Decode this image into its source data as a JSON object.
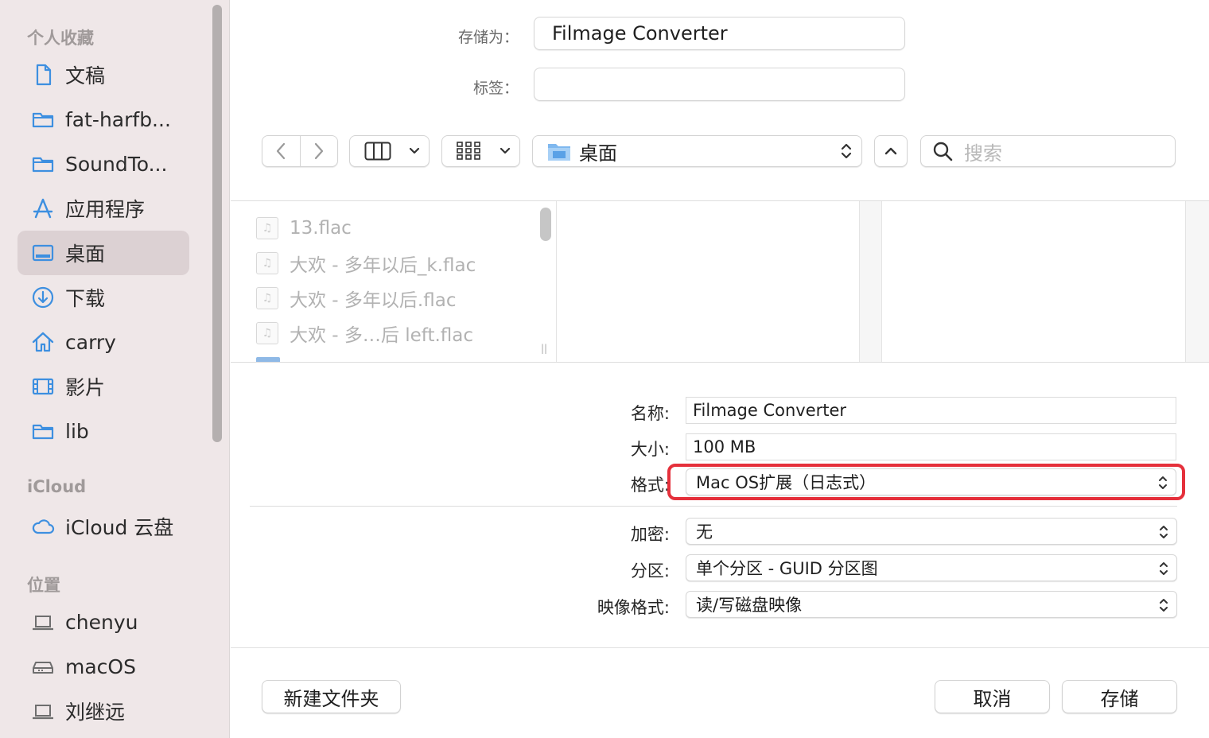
{
  "sidebar": {
    "sections": {
      "favorites": "个人收藏",
      "icloud": "iCloud",
      "locations": "位置"
    },
    "favorites": [
      {
        "label": "文稿",
        "icon": "document-icon"
      },
      {
        "label": "fat-harfb...",
        "icon": "folder-icon"
      },
      {
        "label": "SoundTo...",
        "icon": "folder-icon"
      },
      {
        "label": "应用程序",
        "icon": "apps-icon"
      },
      {
        "label": "桌面",
        "icon": "desktop-icon",
        "selected": true
      },
      {
        "label": "下载",
        "icon": "download-icon"
      },
      {
        "label": "carry",
        "icon": "home-icon"
      },
      {
        "label": "影片",
        "icon": "film-icon"
      },
      {
        "label": "lib",
        "icon": "folder-icon"
      }
    ],
    "icloud_items": [
      {
        "label": "iCloud 云盘",
        "icon": "cloud-icon"
      }
    ],
    "locations": [
      {
        "label": "chenyu",
        "icon": "laptop-icon"
      },
      {
        "label": "macOS",
        "icon": "drive-icon"
      },
      {
        "label": "刘继远",
        "icon": "laptop-icon"
      }
    ]
  },
  "save_form": {
    "save_as_label": "存储为：",
    "save_as_value": "Filmage Converter",
    "tags_label": "标签：",
    "tags_value": ""
  },
  "toolbar": {
    "location": "桌面",
    "search_placeholder": "搜索"
  },
  "browser": {
    "files": [
      "13.flac",
      "大欢 - 多年以后_k.flac",
      "大欢 - 多年以后.flac",
      "大欢 - 多…后 left.flac"
    ]
  },
  "options": {
    "name_label": "名称:",
    "name_value": "Filmage Converter",
    "size_label": "大小:",
    "size_value": "100 MB",
    "format_label": "格式:",
    "format_value": "Mac OS扩展（日志式）",
    "encryption_label": "加密:",
    "encryption_value": "无",
    "partition_label": "分区:",
    "partition_value": "单个分区 - GUID 分区图",
    "image_format_label": "映像格式:",
    "image_format_value": "读/写磁盘映像"
  },
  "buttons": {
    "new_folder": "新建文件夹",
    "cancel": "取消",
    "save": "存储"
  },
  "colors": {
    "sidebar_bg": "#efe7e8",
    "selected_bg": "#dcd1d3",
    "accent_icon": "#3d8fe0",
    "highlight_border": "#e5303b"
  }
}
